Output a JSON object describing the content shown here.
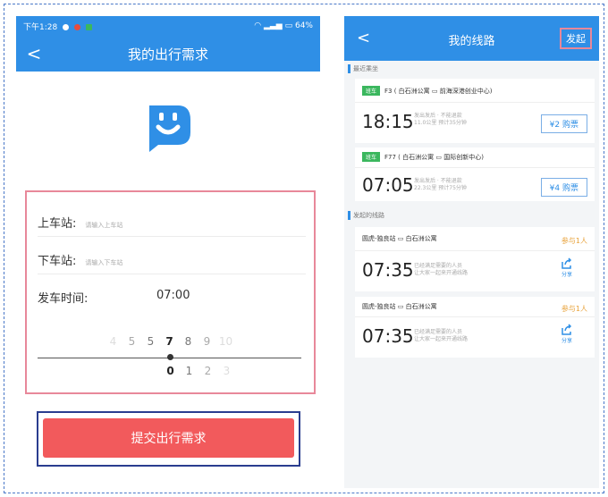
{
  "left": {
    "status": {
      "time": "下午1:28",
      "battery": "64%"
    },
    "nav": {
      "title": "我的出行需求",
      "back": "<"
    },
    "form": {
      "boarding_label": "上车站:",
      "boarding_placeholder": "请输入上车站",
      "alighting_label": "下车站:",
      "alighting_placeholder": "请输入下车站",
      "departure_label": "发车时间:",
      "departure_value": "07:00"
    },
    "picker": {
      "hours": [
        "4",
        "5",
        "5",
        "7",
        "8",
        "9",
        "10"
      ],
      "minutes": [
        "0",
        "1",
        "2",
        "3"
      ]
    },
    "submit_label": "提交出行需求"
  },
  "right": {
    "nav": {
      "title": "我的线路",
      "back": "<",
      "action": "发起"
    },
    "recent_title": "最近乘坐",
    "created_title": "发起的线路",
    "recent": [
      {
        "tag": "班车",
        "route": "F3 ( 白石洲公寓 ▭ 前海深港创业中心)",
        "time": "18:15",
        "sub1": "发出发后 · 不能退款",
        "sub2": "11.0公里 预计35分钟",
        "price": "¥2 购票"
      },
      {
        "tag": "班车",
        "route": "F77 ( 白石洲公寓 ▭ 国际创新中心)",
        "time": "07:05",
        "sub1": "发出发后 · 不能退款",
        "sub2": "22.3公里 预计75分钟",
        "price": "¥4 购票"
      }
    ],
    "created": [
      {
        "route": "圆虎-独良站 ▭ 白石洲公寓",
        "joined": "参与1人",
        "time": "07:35",
        "sub1": "已经满足需要的人员",
        "sub2": "让大家一起来开通线路",
        "share": "分享"
      },
      {
        "route": "圆虎-独良站 ▭ 白石洲公寓",
        "joined": "参与1人",
        "time": "07:35",
        "sub1": "已经满足需要的人员",
        "sub2": "让大家一起来开通线路",
        "share": "分享"
      }
    ]
  },
  "colors": {
    "primary": "#2f8fe6",
    "submit": "#f25a5c",
    "tag": "#3bb75e",
    "joined": "#e8a23a"
  }
}
